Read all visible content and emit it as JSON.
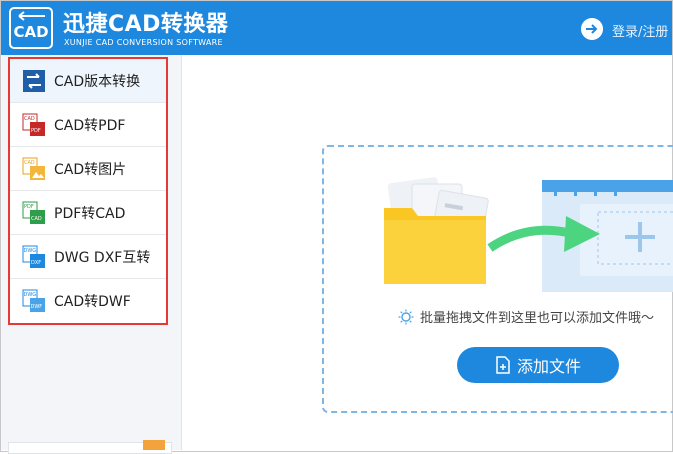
{
  "app": {
    "logo_text": "CAD",
    "title": "迅捷CAD转换器",
    "subtitle": "XUNJIE CAD CONVERSION SOFTWARE",
    "login_label": "登录/注册"
  },
  "sidebar": {
    "items": [
      {
        "label": "CAD版本转换",
        "icon": "version-convert-icon"
      },
      {
        "label": "CAD转PDF",
        "icon": "cad-to-pdf-icon"
      },
      {
        "label": "CAD转图片",
        "icon": "cad-to-image-icon"
      },
      {
        "label": "PDF转CAD",
        "icon": "pdf-to-cad-icon"
      },
      {
        "label": "DWG DXF互转",
        "icon": "dwg-dxf-icon"
      },
      {
        "label": "CAD转DWF",
        "icon": "cad-to-dwf-icon"
      }
    ],
    "active_index": 0
  },
  "main": {
    "hint": "批量拖拽文件到这里也可以添加文件哦～",
    "add_button": "添加文件"
  },
  "colors": {
    "brand": "#1e88df",
    "highlight_border": "#e53935",
    "folder": "#f9c623",
    "arrow": "#4cd480"
  }
}
